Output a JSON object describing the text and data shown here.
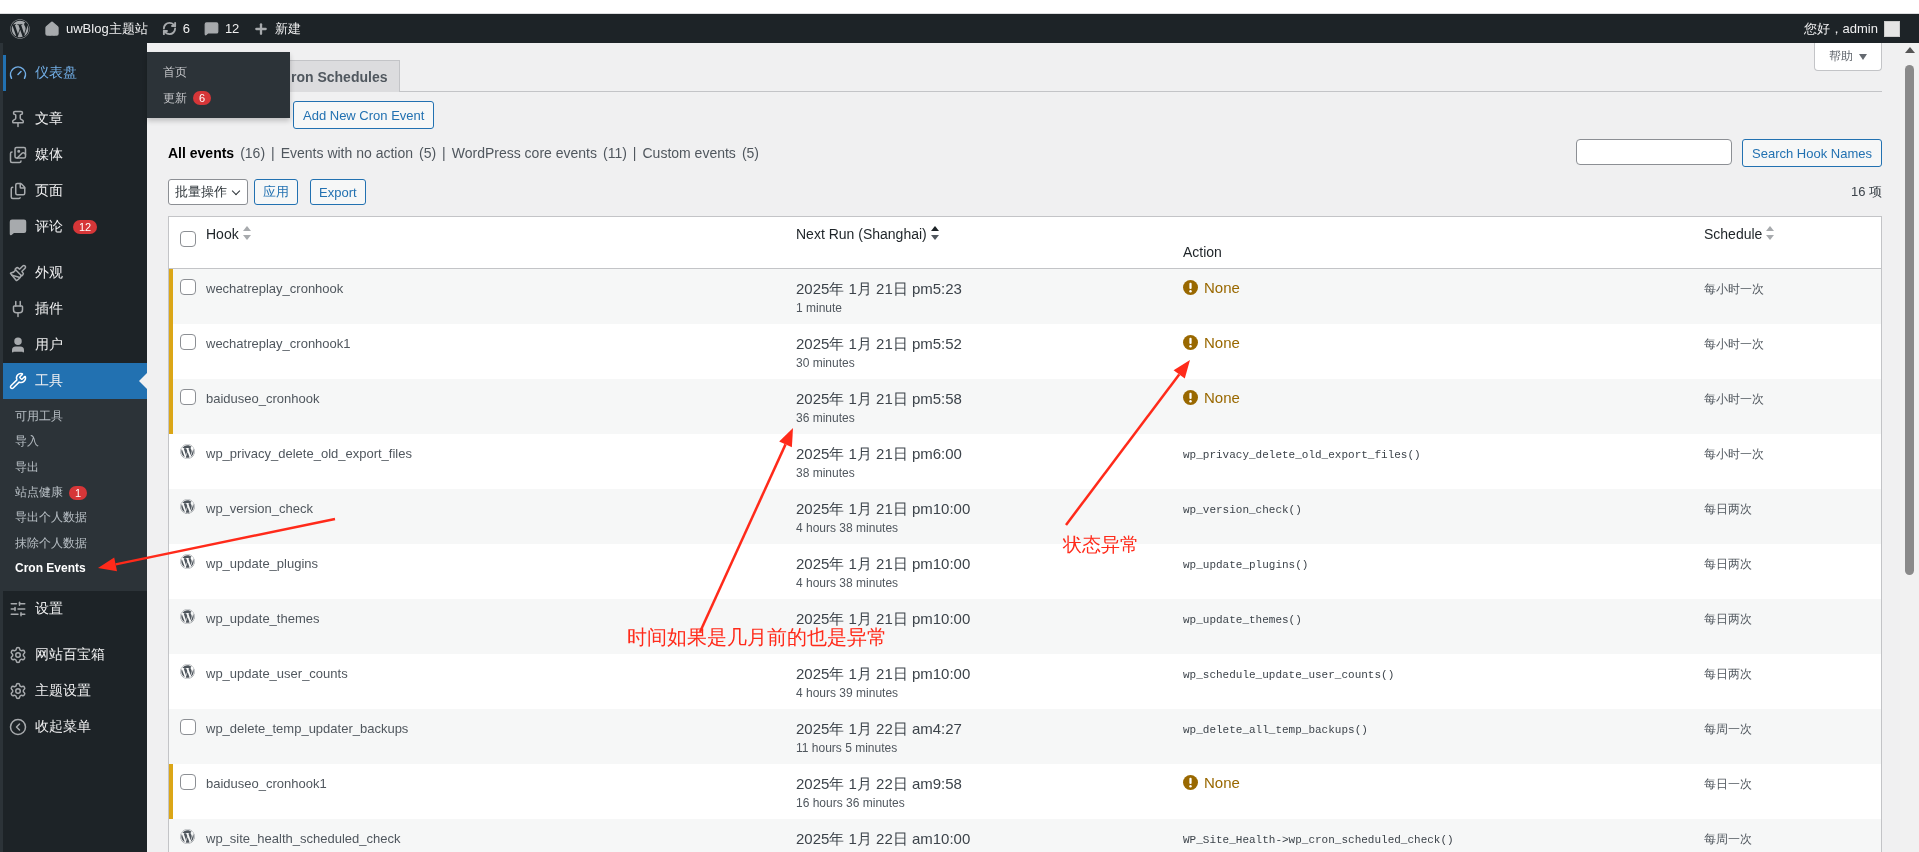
{
  "admin_bar": {
    "site": "uwBlog主题站",
    "updates": "6",
    "comments": "12",
    "new": "新建",
    "greeting": "您好，admin"
  },
  "sidebar": {
    "groups": [
      [
        {
          "label": "仪表盘",
          "hovered": true,
          "selected": false,
          "flyout": [
            {
              "label": "首页"
            },
            {
              "label": "更新",
              "badge": "6"
            }
          ]
        }
      ],
      [
        {
          "label": "文章",
          "hovered": false,
          "selected": false
        },
        {
          "label": "媒体",
          "hovered": false,
          "selected": false
        },
        {
          "label": "页面",
          "hovered": false,
          "selected": false
        },
        {
          "label": "评论",
          "hovered": false,
          "selected": false,
          "badge": "12"
        }
      ],
      [
        {
          "label": "外观",
          "hovered": false,
          "selected": false
        },
        {
          "label": "插件",
          "hovered": false,
          "selected": false
        },
        {
          "label": "用户",
          "hovered": false,
          "selected": false
        },
        {
          "label": "工具",
          "hovered": false,
          "selected": true,
          "children": [
            {
              "label": "可用工具",
              "selected": false
            },
            {
              "label": "导入",
              "selected": false
            },
            {
              "label": "导出",
              "selected": false
            },
            {
              "label": "站点健康",
              "selected": false,
              "badge": "1"
            },
            {
              "label": "导出个人数据",
              "selected": false
            },
            {
              "label": "抹除个人数据",
              "selected": false
            },
            {
              "label": "Cron Events",
              "selected": true
            }
          ]
        },
        {
          "label": "设置",
          "hovered": false,
          "selected": false
        }
      ],
      [
        {
          "label": "网站百宝箱",
          "hovered": false,
          "selected": false
        },
        {
          "label": "主题设置",
          "hovered": false,
          "selected": false
        },
        {
          "label": "收起菜单",
          "hovered": false,
          "selected": false
        }
      ]
    ]
  },
  "help": "帮助",
  "tabs": [
    {
      "label": "ron Schedules",
      "selected": false
    }
  ],
  "add_button": "Add New Cron Event",
  "filters": [
    {
      "label": "All events",
      "count": "(16)",
      "selected": true
    },
    {
      "divider": "|",
      "label": "Events with no action",
      "count": "(5)",
      "selected": false
    },
    {
      "divider": "|",
      "label": "WordPress core events",
      "count": "(11)",
      "selected": false
    },
    {
      "divider": "|",
      "label": "Custom events",
      "count": "(5)",
      "selected": false
    }
  ],
  "search": {
    "button": "Search Hook Names"
  },
  "bulk": {
    "select": "批量操作",
    "apply": "应用",
    "export": "Export",
    "count": "16 项"
  },
  "table": {
    "select_all_checked": false,
    "columns": [
      {
        "label": "Hook",
        "sortable": true,
        "sorted": false
      },
      {
        "label": "Next Run (Shanghai)",
        "sortable": true,
        "sorted": true
      },
      {
        "label": "Action",
        "sortable": false
      },
      {
        "label": "Schedule",
        "sortable": true,
        "sorted": false
      }
    ],
    "rows": [
      {
        "kind": "checkbox",
        "flagged": true,
        "hook": "wechatreplay_cronhook",
        "next_run": "2025年 1月 21日 pm5:23",
        "relative": "1 minute",
        "action": {
          "kind": "missing",
          "text": "None"
        },
        "schedule": "每小时一次"
      },
      {
        "kind": "checkbox",
        "flagged": true,
        "hook": "wechatreplay_cronhook1",
        "next_run": "2025年 1月 21日 pm5:52",
        "relative": "30 minutes",
        "action": {
          "kind": "missing",
          "text": "None"
        },
        "schedule": "每小时一次"
      },
      {
        "kind": "checkbox",
        "flagged": true,
        "hook": "baiduseo_cronhook",
        "next_run": "2025年 1月 21日 pm5:58",
        "relative": "36 minutes",
        "action": {
          "kind": "missing",
          "text": "None"
        },
        "schedule": "每小时一次"
      },
      {
        "kind": "logo",
        "flagged": false,
        "hook": "wp_privacy_delete_old_export_files",
        "next_run": "2025年 1月 21日 pm6:00",
        "relative": "38 minutes",
        "action": {
          "kind": "callback",
          "text": "wp_privacy_delete_old_export_files()"
        },
        "schedule": "每小时一次"
      },
      {
        "kind": "logo",
        "flagged": false,
        "hook": "wp_version_check",
        "next_run": "2025年 1月 21日 pm10:00",
        "relative": "4 hours 38 minutes",
        "action": {
          "kind": "callback",
          "text": "wp_version_check()"
        },
        "schedule": "每日两次"
      },
      {
        "kind": "logo",
        "flagged": false,
        "hook": "wp_update_plugins",
        "next_run": "2025年 1月 21日 pm10:00",
        "relative": "4 hours 38 minutes",
        "action": {
          "kind": "callback",
          "text": "wp_update_plugins()"
        },
        "schedule": "每日两次"
      },
      {
        "kind": "logo",
        "flagged": false,
        "hook": "wp_update_themes",
        "next_run": "2025年 1月 21日 pm10:00",
        "action": {
          "kind": "callback",
          "text": "wp_update_themes()"
        },
        "schedule": "每日两次"
      },
      {
        "kind": "logo",
        "flagged": false,
        "hook": "wp_update_user_counts",
        "next_run": "2025年 1月 21日 pm10:00",
        "relative": "4 hours 39 minutes",
        "action": {
          "kind": "callback",
          "text": "wp_schedule_update_user_counts()"
        },
        "schedule": "每日两次"
      },
      {
        "kind": "checkbox",
        "flagged": false,
        "hook": "wp_delete_temp_updater_backups",
        "next_run": "2025年 1月 22日 am4:27",
        "relative": "11 hours 5 minutes",
        "action": {
          "kind": "callback",
          "text": "wp_delete_all_temp_backups()"
        },
        "schedule": "每周一次"
      },
      {
        "kind": "checkbox",
        "flagged": true,
        "hook": "baiduseo_cronhook1",
        "next_run": "2025年 1月 22日 am9:58",
        "relative": "16 hours 36 minutes",
        "action": {
          "kind": "missing",
          "text": "None"
        },
        "schedule": "每日一次"
      },
      {
        "kind": "logo",
        "flagged": false,
        "hook": "wp_site_health_scheduled_check",
        "next_run": "2025年 1月 22日 am10:00",
        "action": {
          "kind": "callback",
          "text": "WP_Site_Health->wp_cron_scheduled_check()"
        },
        "schedule": "每周一次"
      }
    ]
  },
  "annotations": [
    {
      "text": "状态异常"
    },
    {
      "text": "时间如果是几月前的也是异常"
    }
  ]
}
